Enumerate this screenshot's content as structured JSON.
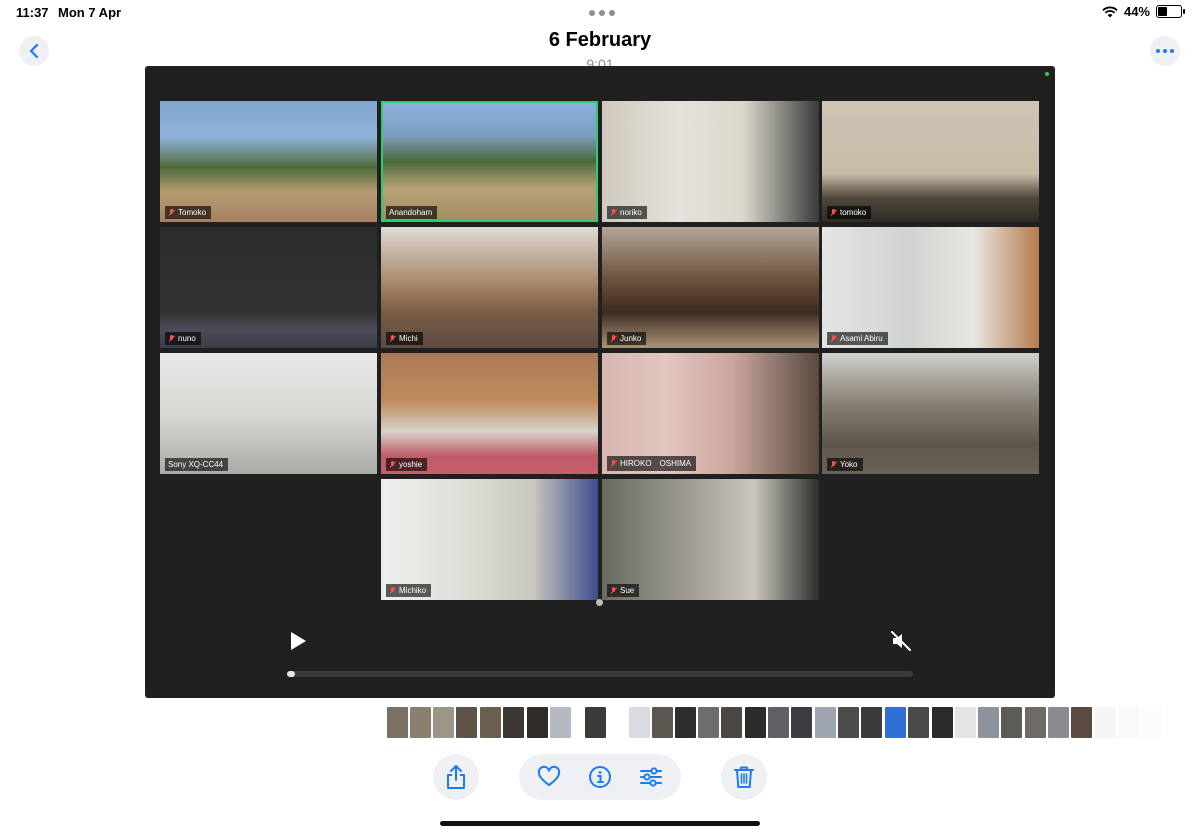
{
  "status_bar": {
    "time": "11:37",
    "date": "Mon 7 Apr",
    "battery_percent": "44%",
    "battery_level": 0.44
  },
  "header": {
    "title": "6 February",
    "subtitle": "9:01"
  },
  "icons": {
    "back": "chevron-left-icon",
    "more": "ellipsis-icon",
    "play": "play-icon",
    "mute": "speaker-muted-icon",
    "share": "share-icon",
    "favorite": "heart-icon",
    "info": "info-icon",
    "adjust": "sliders-icon",
    "delete": "trash-icon"
  },
  "colors": {
    "accent": "#1a7cf5",
    "video_bg": "#202020",
    "active_speaker": "#2ecc71",
    "muted_mic": "#ff4f4f"
  },
  "playback": {
    "progress": 0.01
  },
  "participants": [
    {
      "name": "Tomoko",
      "muted": true
    },
    {
      "name": "Anandoham",
      "muted": false,
      "active": true
    },
    {
      "name": "noriko",
      "muted": true
    },
    {
      "name": "tomoko",
      "muted": true
    },
    {
      "name": "nuno",
      "muted": true
    },
    {
      "name": "Michi",
      "muted": true
    },
    {
      "name": "Junko",
      "muted": true
    },
    {
      "name": "Asami Abiru",
      "muted": true
    },
    {
      "name": "Sony XQ-CC44",
      "muted": false
    },
    {
      "name": "yoshie",
      "muted": true
    },
    {
      "name": "HIROKO　OSHIMA",
      "muted": true
    },
    {
      "name": "Yoko",
      "muted": true
    },
    {
      "name": "Michiko",
      "muted": true
    },
    {
      "name": "Sue",
      "muted": true
    }
  ]
}
